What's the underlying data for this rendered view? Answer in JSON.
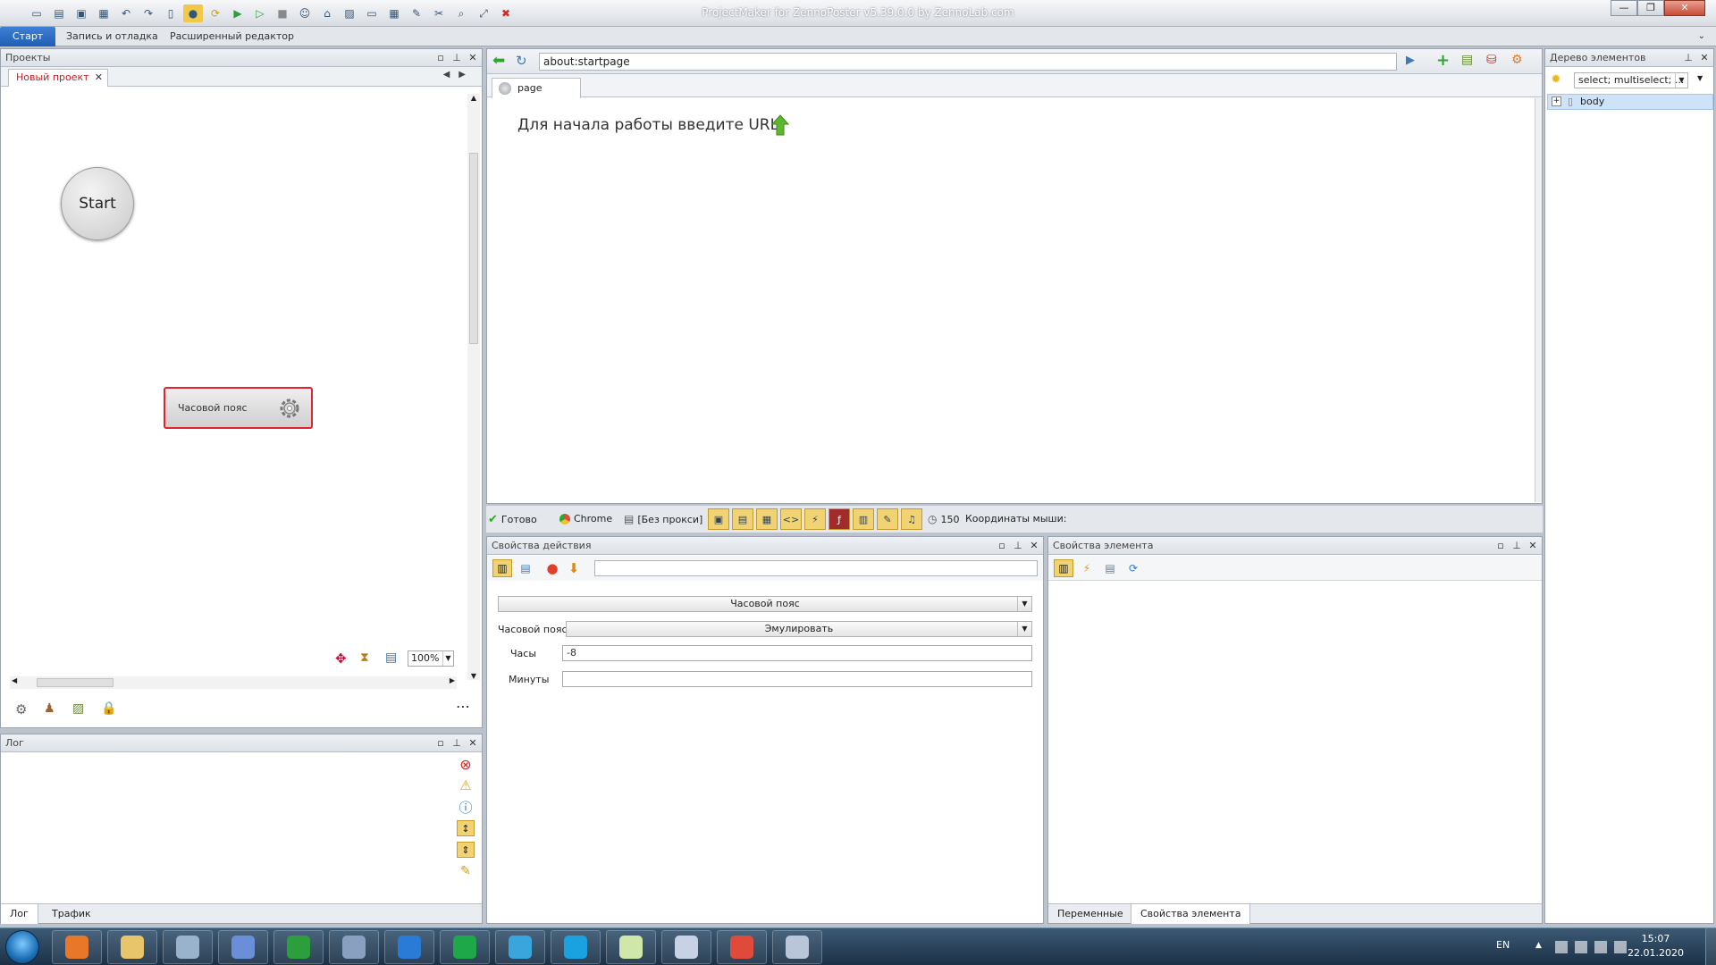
{
  "window": {
    "title": "ProjectMaker for ZennoPoster v5.39.0.0 by ZennoLab.com",
    "minimize": "—",
    "maximize": "❐",
    "close": "✕"
  },
  "ribbon_tabs": [
    "Старт",
    "Запись и отладка",
    "Расширенный редактор"
  ],
  "projects_panel": {
    "title": "Проекты",
    "tab_label": "Новый проект",
    "tab_close": "✕",
    "start_node": "Старт",
    "start_node_label": "Start",
    "action_node": "Часовой пояс",
    "zoom": "100%"
  },
  "log_panel": {
    "title": "Лог",
    "tabs": [
      "Лог",
      "Трафик"
    ]
  },
  "browser": {
    "url": "about:startpage",
    "page_tab": "page",
    "hint": "Для начала работы введите URL"
  },
  "statusbar": {
    "status": "Готово",
    "engine": "Chrome",
    "proxy": "[Без прокси]",
    "count": "150",
    "mouse_coords_label": "Координаты мыши:"
  },
  "action_props": {
    "title": "Свойства действия",
    "action_combo": "Часовой пояс",
    "tz_label": "Часовой пояс",
    "tz_mode": "Эмулировать",
    "hours_label": "Часы",
    "hours_value": "-8",
    "minutes_label": "Минуты",
    "minutes_value": ""
  },
  "element_props": {
    "title": "Свойства элемента",
    "tabs": [
      "Переменные",
      "Свойства элемента"
    ]
  },
  "element_tree": {
    "title": "Дерево элементов",
    "filter": "select; multiselect; ...",
    "root": "body"
  },
  "taskbar": {
    "lang": "EN",
    "time": "15:07",
    "date": "22.01.2020",
    "apps": [
      {
        "name": "media-player",
        "color": "#e8772a"
      },
      {
        "name": "file-explorer",
        "color": "#e8c56a"
      },
      {
        "name": "calculator",
        "color": "#9ab3cc"
      },
      {
        "name": "network-app",
        "color": "#6a8fd8"
      },
      {
        "name": "green-app",
        "color": "#2c9e3c"
      },
      {
        "name": "zennoposter",
        "color": "#8aa0c0"
      },
      {
        "name": "vscode",
        "color": "#2a7bd6"
      },
      {
        "name": "s-app-green",
        "color": "#1fa84a"
      },
      {
        "name": "telegram",
        "color": "#39a5dc"
      },
      {
        "name": "skype",
        "color": "#1aa1e0"
      },
      {
        "name": "chart-app",
        "color": "#cfe7a8"
      },
      {
        "name": "editor-app",
        "color": "#c8d2e6"
      },
      {
        "name": "chrome",
        "color": "#e04a3a"
      },
      {
        "name": "projectmaker",
        "color": "#b9c5d8"
      }
    ]
  }
}
